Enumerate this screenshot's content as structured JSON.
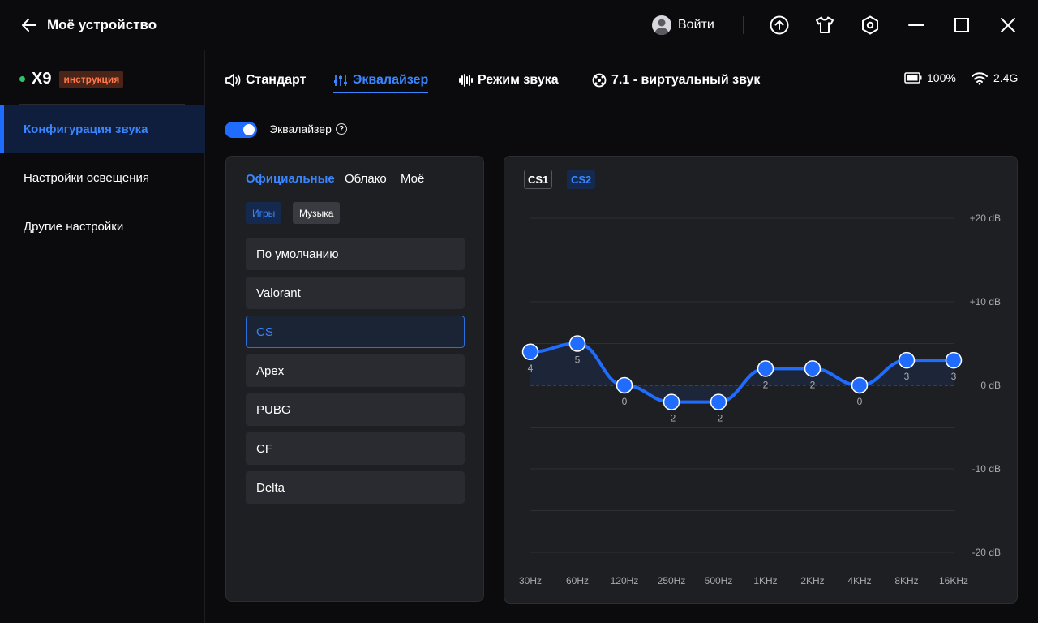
{
  "titlebar": {
    "title": "Моё устройство",
    "login_label": "Войти",
    "icons": [
      "back-arrow-icon",
      "user-avatar-icon",
      "upload-icon",
      "tshirt-icon",
      "settings-hexagon-icon",
      "minimize-icon",
      "maximize-icon",
      "close-icon"
    ]
  },
  "sidebar": {
    "device_name": "X9",
    "device_badge": "инструкция",
    "status_color": "#2ec26a",
    "items": [
      {
        "label": "Конфигурация звука",
        "active": true
      },
      {
        "label": "Настройки освещения",
        "active": false
      },
      {
        "label": "Другие настройки",
        "active": false
      }
    ]
  },
  "tabs": [
    {
      "label": "Стандарт",
      "icon": "speaker-icon"
    },
    {
      "label": "Эквалайзер",
      "icon": "sliders-icon",
      "active": true
    },
    {
      "label": "Режим звука",
      "icon": "waveform-icon"
    },
    {
      "label": "7.1 - виртуальный звук",
      "icon": "surround-icon"
    }
  ],
  "status": {
    "battery": "100%",
    "wireless": "2.4G"
  },
  "equalizer": {
    "label": "Эквалайзер",
    "enabled": true
  },
  "presets": {
    "source_tabs": [
      "Официальные",
      "Облако",
      "Моё"
    ],
    "categories": [
      "Игры",
      "Музыка"
    ],
    "items": [
      "По умолчанию",
      "Valorant",
      "CS",
      "Apex",
      "PUBG",
      "CF",
      "Delta"
    ],
    "selected": "CS"
  },
  "cs_tabs": [
    "CS1",
    "CS2"
  ],
  "accent_color": "#1f6cff",
  "chart_data": {
    "type": "line",
    "x": [
      "30Hz",
      "60Hz",
      "120Hz",
      "250Hz",
      "500Hz",
      "1KHz",
      "2KHz",
      "4KHz",
      "8KHz",
      "16KHz"
    ],
    "values": [
      4,
      5,
      0,
      -2,
      -2,
      2,
      2,
      0,
      3,
      3
    ],
    "value_labels": [
      "4",
      "5",
      "0",
      "-2",
      "-2",
      "2",
      "2",
      "0",
      "3",
      "3"
    ],
    "y_ticks": [
      "+20 dB",
      "+10 dB",
      "0 dB",
      "-10 dB",
      "-20 dB"
    ],
    "ylim": [
      -20,
      20
    ],
    "grid": true
  }
}
